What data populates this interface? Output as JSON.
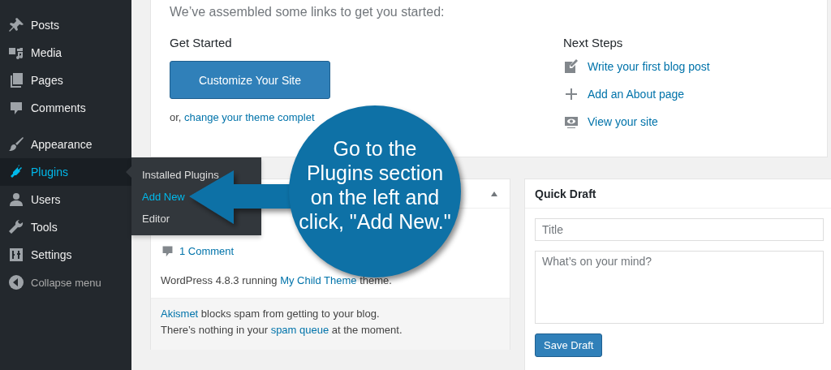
{
  "sidebar": {
    "groups": [
      [
        {
          "label": "Posts",
          "selected": false
        },
        {
          "label": "Media",
          "selected": false
        },
        {
          "label": "Pages",
          "selected": false
        },
        {
          "label": "Comments",
          "selected": false
        }
      ],
      [
        {
          "label": "Appearance",
          "selected": false
        },
        {
          "label": "Plugins",
          "selected": true
        },
        {
          "label": "Users",
          "selected": false
        },
        {
          "label": "Tools",
          "selected": false
        },
        {
          "label": "Settings",
          "selected": false
        }
      ]
    ],
    "collapse_label": "Collapse menu",
    "flyout": [
      {
        "label": "Installed Plugins",
        "selected": false
      },
      {
        "label": "Add New",
        "selected": true
      },
      {
        "label": "Editor",
        "selected": false
      }
    ]
  },
  "welcome": {
    "intro": "We’ve assembled some links to get you started:",
    "get_started": {
      "heading": "Get Started",
      "button": "Customize Your Site",
      "prefix": "or,",
      "link": "change your theme complet"
    },
    "next_steps": {
      "heading": "Next Steps",
      "links": [
        {
          "label": "Write your first blog post"
        },
        {
          "label": "Add an About page"
        },
        {
          "label": "View your site"
        }
      ]
    }
  },
  "at_a_glance": {
    "expanded": true,
    "comments": "1 Comment",
    "version": {
      "prefix": "WordPress 4.8.3 running ",
      "link": "My Child Theme",
      "suffix": " theme."
    },
    "akismet": [
      {
        "link": "Akismet",
        "suffix": " blocks spam from getting to your blog."
      },
      {
        "prefix": "There’s nothing in your ",
        "link": "spam queue",
        "suffix": " at the moment."
      }
    ]
  },
  "quick_draft": {
    "title": "Quick Draft",
    "title_placeholder": "Title",
    "content_placeholder": "What’s on your mind?",
    "button": "Save Draft"
  },
  "callout": {
    "text": "Go to the\nPlugins section\non the left and\nclick, \"Add New.\""
  }
}
